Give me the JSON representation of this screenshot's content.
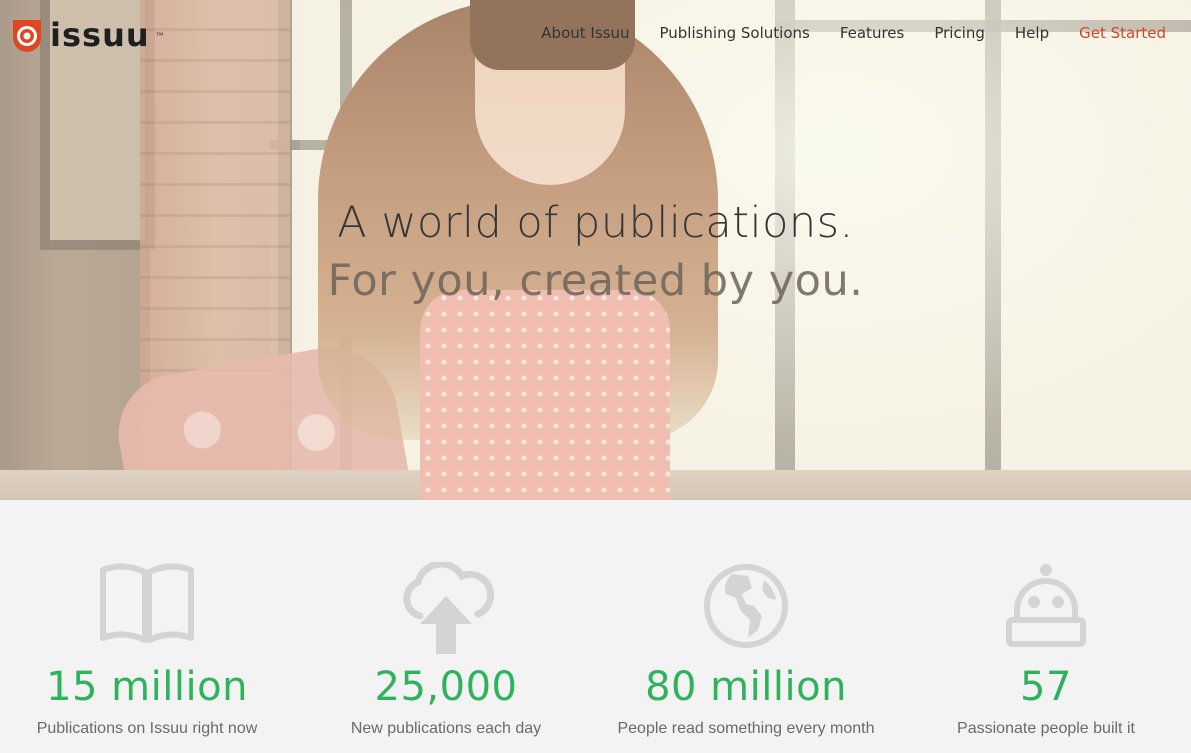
{
  "logo": {
    "text": "issuu",
    "tm": "™"
  },
  "nav": {
    "items": [
      {
        "label": "About Issuu"
      },
      {
        "label": "Publishing Solutions"
      },
      {
        "label": "Features"
      },
      {
        "label": "Pricing"
      },
      {
        "label": "Help"
      },
      {
        "label": "Get Started"
      }
    ]
  },
  "hero": {
    "line1": "A world of publications.",
    "line2": "For you, created by you."
  },
  "stats": [
    {
      "icon": "book-icon",
      "number": "15 million",
      "label": "Publications on Issuu right now"
    },
    {
      "icon": "cloud-upload-icon",
      "number": "25,000",
      "label": "New publications each day"
    },
    {
      "icon": "globe-icon",
      "number": "80 million",
      "label": "People read something every month"
    },
    {
      "icon": "robot-icon",
      "number": "57",
      "label": "Passionate people built it"
    }
  ],
  "colors": {
    "accent": "#d2452a",
    "stat_green": "#2eb35c",
    "icon_gray": "#d4d4d4"
  }
}
